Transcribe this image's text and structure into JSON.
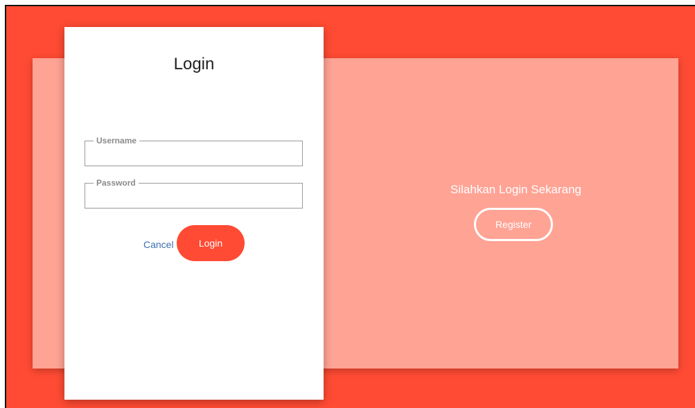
{
  "colors": {
    "background": "#ff4b33",
    "panel": "#ffa395",
    "card": "#ffffff",
    "accent": "#ff4b33",
    "link": "#3f6fb0"
  },
  "login_card": {
    "title": "Login",
    "username": {
      "label": "Username",
      "value": ""
    },
    "password": {
      "label": "Password",
      "value": ""
    },
    "cancel_label": "Cancel",
    "login_label": "Login"
  },
  "register_panel": {
    "prompt": "Silahkan Login Sekarang",
    "register_label": "Register"
  }
}
